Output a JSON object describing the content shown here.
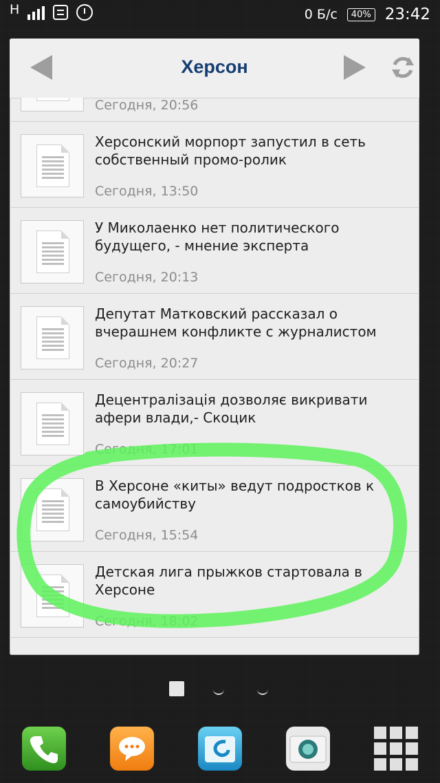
{
  "status_bar": {
    "network": "H",
    "speed": "0 Б/с",
    "battery": "40%",
    "time": "23:42"
  },
  "widget": {
    "title": "Херсон",
    "items": [
      {
        "title": "",
        "time": "Сегодня, 20:56"
      },
      {
        "title": "Херсонский морпорт запустил в сеть собственный промо-ролик",
        "time": "Сегодня, 13:50"
      },
      {
        "title": "У Миколаенко нет политического будущего, - мнение эксперта",
        "time": "Сегодня, 20:13"
      },
      {
        "title": "Депутат Матковский рассказал о вчерашнем конфликте с журналистом",
        "time": "Сегодня, 20:27"
      },
      {
        "title": "Децентралізація дозволяє викривати афери влади,- Скоцик",
        "time": "Сегодня, 17:01"
      },
      {
        "title": "В Херсоне «киты» ведут подростков к самоубийству",
        "time": "Сегодня, 15:54"
      },
      {
        "title": "Детская лига прыжков стартовала в Херсоне",
        "time": "Сегодня, 18:02"
      }
    ]
  },
  "dock": {
    "icons": [
      "phone-icon",
      "messages-icon",
      "file-manager-icon",
      "camera-icon",
      "app-drawer-icon"
    ]
  },
  "colors": {
    "title": "#173e72",
    "highlight": "#5df25a"
  }
}
